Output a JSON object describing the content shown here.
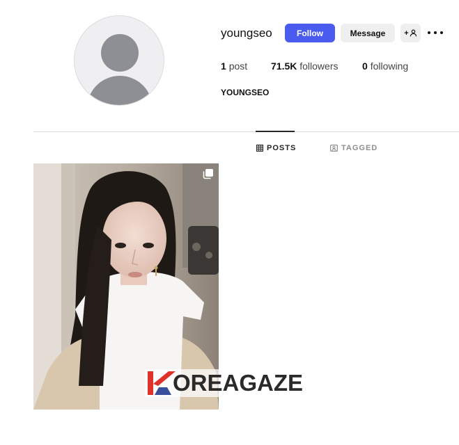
{
  "profile": {
    "username": "youngseo",
    "full_name": "YOUNGSEO",
    "avatar_icon": "default-avatar-icon"
  },
  "actions": {
    "follow_label": "Follow",
    "message_label": "Message",
    "add_user_label": "+",
    "add_user_icon": "person-icon",
    "more_icon": "more-options-icon"
  },
  "stats": {
    "posts_count": "1",
    "posts_label": "post",
    "followers_count": "71.5K",
    "followers_label": "followers",
    "following_count": "0",
    "following_label": "following"
  },
  "tabs": [
    {
      "label": "POSTS",
      "icon": "grid-icon",
      "active": true
    },
    {
      "label": "TAGGED",
      "icon": "tagged-icon",
      "active": false
    }
  ],
  "posts": [
    {
      "type": "carousel",
      "icon": "multiple-photos-icon"
    }
  ],
  "watermark": {
    "text": "OREAGAZE",
    "logo_letter": "K"
  },
  "colors": {
    "follow_button": "#4a5cf0",
    "secondary_button": "#efefef",
    "watermark_red": "#e0322a",
    "watermark_blue": "#3a4f9c"
  }
}
